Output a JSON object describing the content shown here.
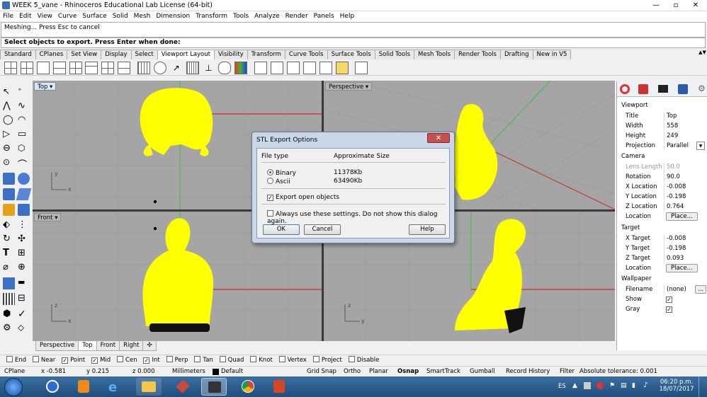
{
  "window": {
    "title": "WEEK 5_vane - Rhinoceros Educational Lab License (64-bit)"
  },
  "menu": [
    "File",
    "Edit",
    "View",
    "Curve",
    "Surface",
    "Solid",
    "Mesh",
    "Dimension",
    "Transform",
    "Tools",
    "Analyze",
    "Render",
    "Panels",
    "Help"
  ],
  "command": {
    "history": "Meshing... Press Esc to cancel",
    "prompt": "Select objects to export. Press Enter when done:"
  },
  "toolbar_tabs": [
    "Standard",
    "CPlanes",
    "Set View",
    "Display",
    "Select",
    "Viewport Layout",
    "Visibility",
    "Transform",
    "Curve Tools",
    "Surface Tools",
    "Solid Tools",
    "Mesh Tools",
    "Render Tools",
    "Drafting",
    "New in V5"
  ],
  "active_toolbar_tab": "Viewport Layout",
  "viewports": {
    "top": "Top",
    "perspective": "Perspective",
    "front": "Front"
  },
  "viewport_tabs": [
    "Perspective",
    "Top",
    "Front",
    "Right"
  ],
  "active_viewport_tab": "Top",
  "osnaps": [
    {
      "label": "End",
      "checked": false
    },
    {
      "label": "Near",
      "checked": false
    },
    {
      "label": "Point",
      "checked": true
    },
    {
      "label": "Mid",
      "checked": true
    },
    {
      "label": "Cen",
      "checked": false
    },
    {
      "label": "Int",
      "checked": true
    },
    {
      "label": "Perp",
      "checked": false
    },
    {
      "label": "Tan",
      "checked": false
    },
    {
      "label": "Quad",
      "checked": false
    },
    {
      "label": "Knot",
      "checked": false
    },
    {
      "label": "Vertex",
      "checked": false
    },
    {
      "label": "Project",
      "checked": false
    },
    {
      "label": "Disable",
      "checked": false
    }
  ],
  "status": {
    "cplane": "CPlane",
    "x": "x -0.581",
    "y": "y 0.215",
    "z": "z 0.000",
    "units": "Millimeters",
    "layer": "Default",
    "grid_snap": "Grid Snap",
    "ortho": "Ortho",
    "planar": "Planar",
    "osnap": "Osnap",
    "smarttrack": "SmartTrack",
    "gumball": "Gumball",
    "record_history": "Record History",
    "filter": "Filter",
    "tolerance": "Absolute tolerance: 0.001"
  },
  "panel": {
    "viewport_header": "Viewport",
    "title_k": "Title",
    "title_v": "Top",
    "width_k": "Width",
    "width_v": "558",
    "height_k": "Height",
    "height_v": "249",
    "projection_k": "Projection",
    "projection_v": "Parallel",
    "camera_header": "Camera",
    "lens_k": "Lens Length",
    "lens_v": "50.0",
    "rotation_k": "Rotation",
    "rotation_v": "90.0",
    "xloc_k": "X Location",
    "xloc_v": "-0.008",
    "yloc_k": "Y Location",
    "yloc_v": "-0.198",
    "zloc_k": "Z Location",
    "zloc_v": "0.764",
    "location_k": "Location",
    "place_label": "Place...",
    "target_header": "Target",
    "xt_k": "X Target",
    "xt_v": "-0.008",
    "yt_k": "Y Target",
    "yt_v": "-0.198",
    "zt_k": "Z Target",
    "zt_v": "0.093",
    "tloc_k": "Location",
    "wallpaper_header": "Wallpaper",
    "filename_k": "Filename",
    "filename_v": "(none)",
    "show_k": "Show",
    "gray_k": "Gray",
    "browse_label": "..."
  },
  "dialog": {
    "title": "STL Export Options",
    "close": "✕",
    "col_filetype": "File type",
    "col_size": "Approximate Size",
    "binary": "Binary",
    "binary_size": "11378Kb",
    "ascii": "Ascii",
    "ascii_size": "63490Kb",
    "export_open": "Export open objects",
    "always_use": "Always use these settings. Do not show this dialog again.",
    "ok": "OK",
    "cancel": "Cancel",
    "help": "Help"
  },
  "tray": {
    "lang": "ES",
    "time": "06:20 p.m.",
    "date": "18/07/2017"
  },
  "colors": {
    "model": "#ffff00",
    "viewport_bg": "#a5a5a5",
    "x_axis": "#c83232",
    "y_axis": "#3cbf3c"
  }
}
